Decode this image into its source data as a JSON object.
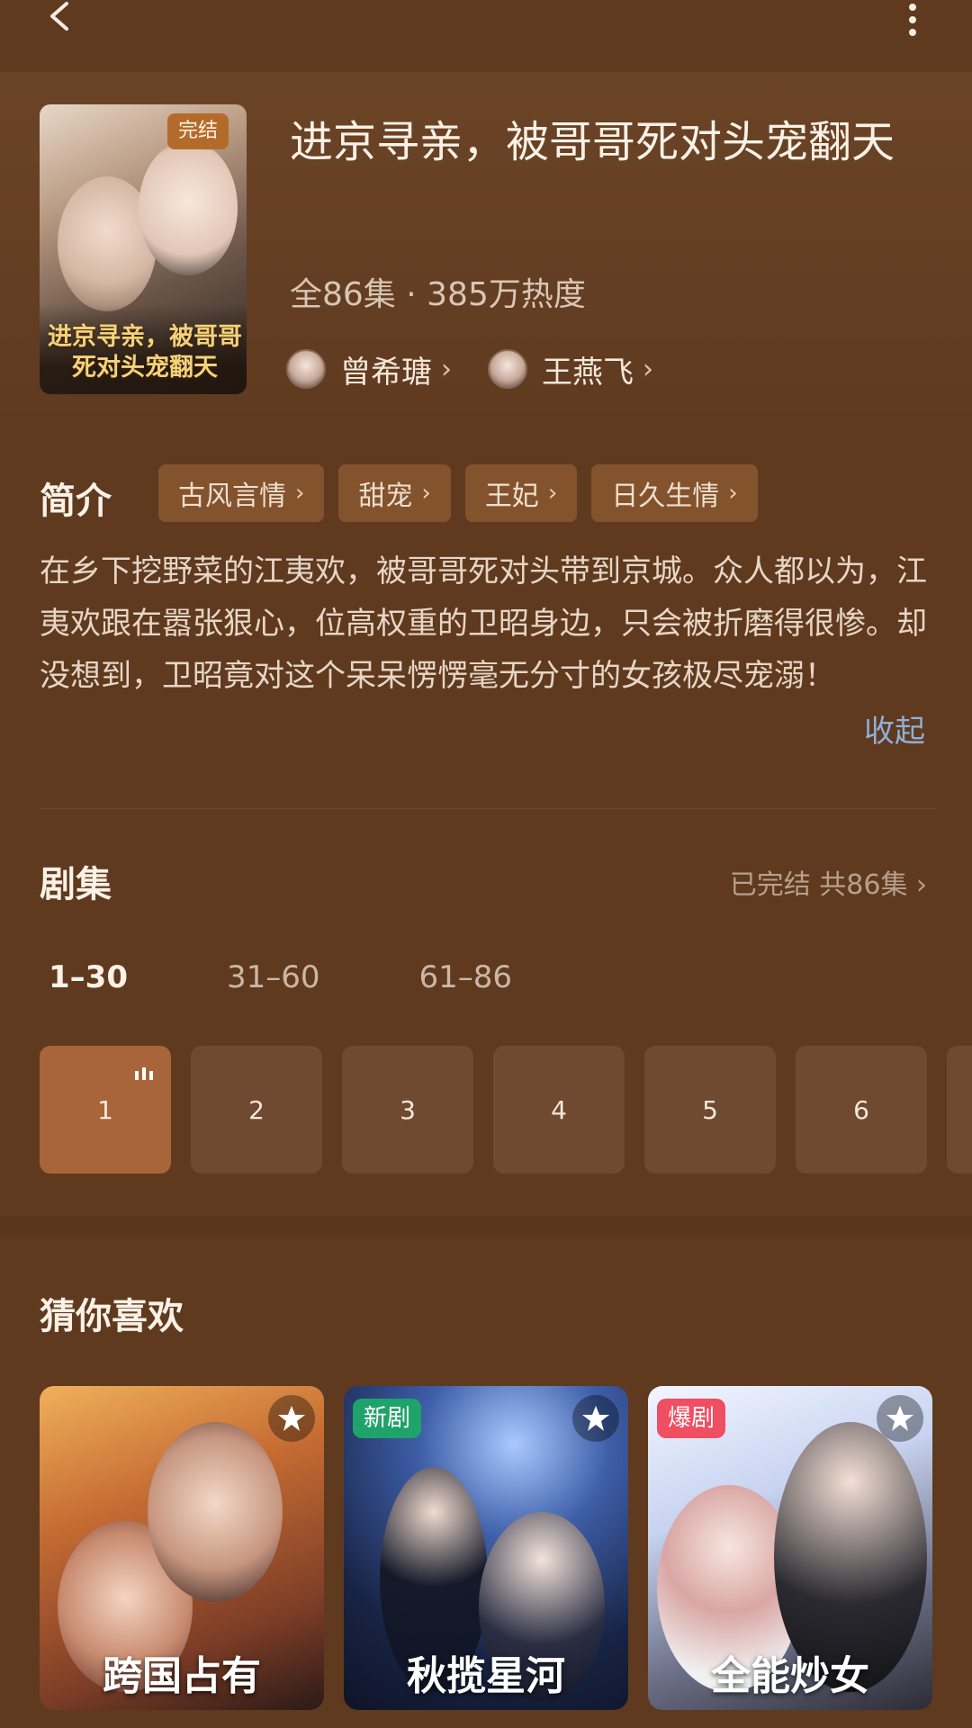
{
  "header": {
    "back_icon": "chevron-left-icon",
    "more_icon": "vertical-dots-icon"
  },
  "drama": {
    "status_badge": "完结",
    "poster_title": "进京寻亲，被哥哥死对头宠翻天",
    "title": "进京寻亲，被哥哥死对头宠翻天",
    "meta": "全86集 · 385万热度",
    "actors": [
      {
        "name": "曾希瑭"
      },
      {
        "name": "王燕飞"
      }
    ]
  },
  "intro": {
    "label": "简介",
    "tags": [
      "古风言情",
      "甜宠",
      "王妃",
      "日久生情"
    ],
    "summary": "在乡下挖野菜的江夷欢，被哥哥死对头带到京城。众人都以为，江夷欢跟在嚣张狠心，位高权重的卫昭身边，只会被折磨得很惨。却没想到，卫昭竟对这个呆呆愣愣毫无分寸的女孩极尽宠溺！",
    "collapse_label": "收起"
  },
  "episodes": {
    "label": "剧集",
    "status": "已完结 共86集",
    "ranges": [
      "1–30",
      "31–60",
      "61–86"
    ],
    "active_range": 0,
    "items": [
      "1",
      "2",
      "3",
      "4",
      "5",
      "6"
    ],
    "active_episode": 0
  },
  "recommend": {
    "label": "猜你喜欢",
    "cards": [
      {
        "title_art": "跨国占有",
        "badge": ""
      },
      {
        "title_art": "秋揽星河",
        "badge": "新剧"
      },
      {
        "title_art": "全能炒女",
        "badge": "爆剧"
      }
    ]
  },
  "colors": {
    "background": "#5f3a1f",
    "tag_bg": "#83532d",
    "episode_active": "#a76539",
    "episode_bg": "#6f4930",
    "link_blue": "#8fb0d6",
    "badge_new": "#1fa36a",
    "badge_hot": "#f04e62"
  }
}
